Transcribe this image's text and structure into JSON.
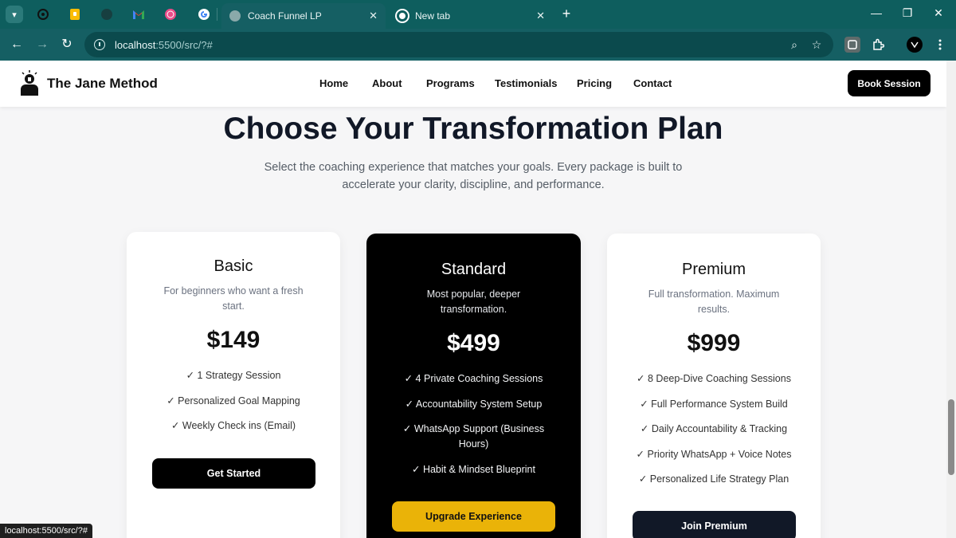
{
  "browser": {
    "tabs": [
      {
        "label": "Coach Funnel LP",
        "active": true
      },
      {
        "label": "New tab",
        "active": false
      }
    ],
    "address": {
      "host": "localhost",
      "path": ":5500/src/?#"
    },
    "status_url": "localhost:5500/src/?#",
    "icons": {
      "back": "←",
      "forward": "→",
      "reload": "↻",
      "zoom": "⌕",
      "star": "☆",
      "newtab": "+",
      "close": "✕",
      "minimize": "—",
      "restore": "❐"
    }
  },
  "site": {
    "brand": "The Jane Method",
    "nav": [
      "Home",
      "About",
      "Programs",
      "Testimonials",
      "Pricing",
      "Contact"
    ],
    "book_label": "Book Session"
  },
  "pricing": {
    "title": "Choose Your Transformation Plan",
    "subtitle": "Select the coaching experience that matches your goals. Every package is built to accelerate your clarity, discipline, and performance.",
    "plans": [
      {
        "name": "Basic",
        "desc": "For beginners who want a fresh start.",
        "price": "$149",
        "features": [
          "✓ 1 Strategy Session",
          "✓ Personalized Goal Mapping",
          "✓ Weekly Check ins (Email)"
        ],
        "cta": "Get Started"
      },
      {
        "name": "Standard",
        "desc": "Most popular, deeper transformation.",
        "price": "$499",
        "features": [
          "✓ 4 Private Coaching Sessions",
          "✓ Accountability System Setup",
          "✓ WhatsApp Support (Business Hours)",
          "✓ Habit & Mindset Blueprint"
        ],
        "cta": "Upgrade Experience"
      },
      {
        "name": "Premium",
        "desc": "Full transformation. Maximum results.",
        "price": "$999",
        "features": [
          "✓ 8 Deep-Dive Coaching Sessions",
          "✓ Full Performance System Build",
          "✓ Daily Accountability & Tracking",
          "✓ Priority WhatsApp + Voice Notes",
          "✓ Personalized Life Strategy Plan"
        ],
        "cta": "Join Premium"
      }
    ]
  },
  "colors": {
    "chrome": "#0e5e5e",
    "accent_gold": "#eab308",
    "dark_button": "#111827"
  }
}
